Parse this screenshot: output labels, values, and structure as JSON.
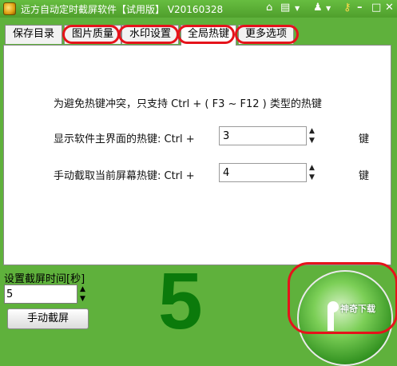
{
  "window": {
    "title": "远方自动定时截屏软件【试用版】 V20160328"
  },
  "titlebar_icons": [
    "home-icon",
    "menu-icon",
    "dropdown-icon",
    "user-icon",
    "dropdown-icon",
    "key-icon",
    "minimize-icon",
    "maximize-icon",
    "close-icon"
  ],
  "tabs": [
    {
      "label": "保存目录"
    },
    {
      "label": "图片质量"
    },
    {
      "label": "水印设置"
    },
    {
      "label": "全局热键"
    },
    {
      "label": "更多选项"
    }
  ],
  "active_tab": "全局热键",
  "hotkeys": {
    "note": "为避免热键冲突，只支持 Ctrl + ( F3 ~ F12 ) 类型的热键",
    "show_main_label": "显示软件主界面的热键:  Ctrl +",
    "show_main_value": "3",
    "capture_label": "手动截取当前屏幕热键:  Ctrl +",
    "capture_value": "4",
    "unit": "键"
  },
  "bottom": {
    "interval_label": "设置截屏时间[秒]",
    "interval_value": "5",
    "manual_button": "手动截屏",
    "countdown": "5"
  },
  "watermark": "神奇下载",
  "colors": {
    "window_green": "#5fb13c",
    "highlight_red": "#e5131b",
    "countdown_green": "#0b7a0b"
  }
}
